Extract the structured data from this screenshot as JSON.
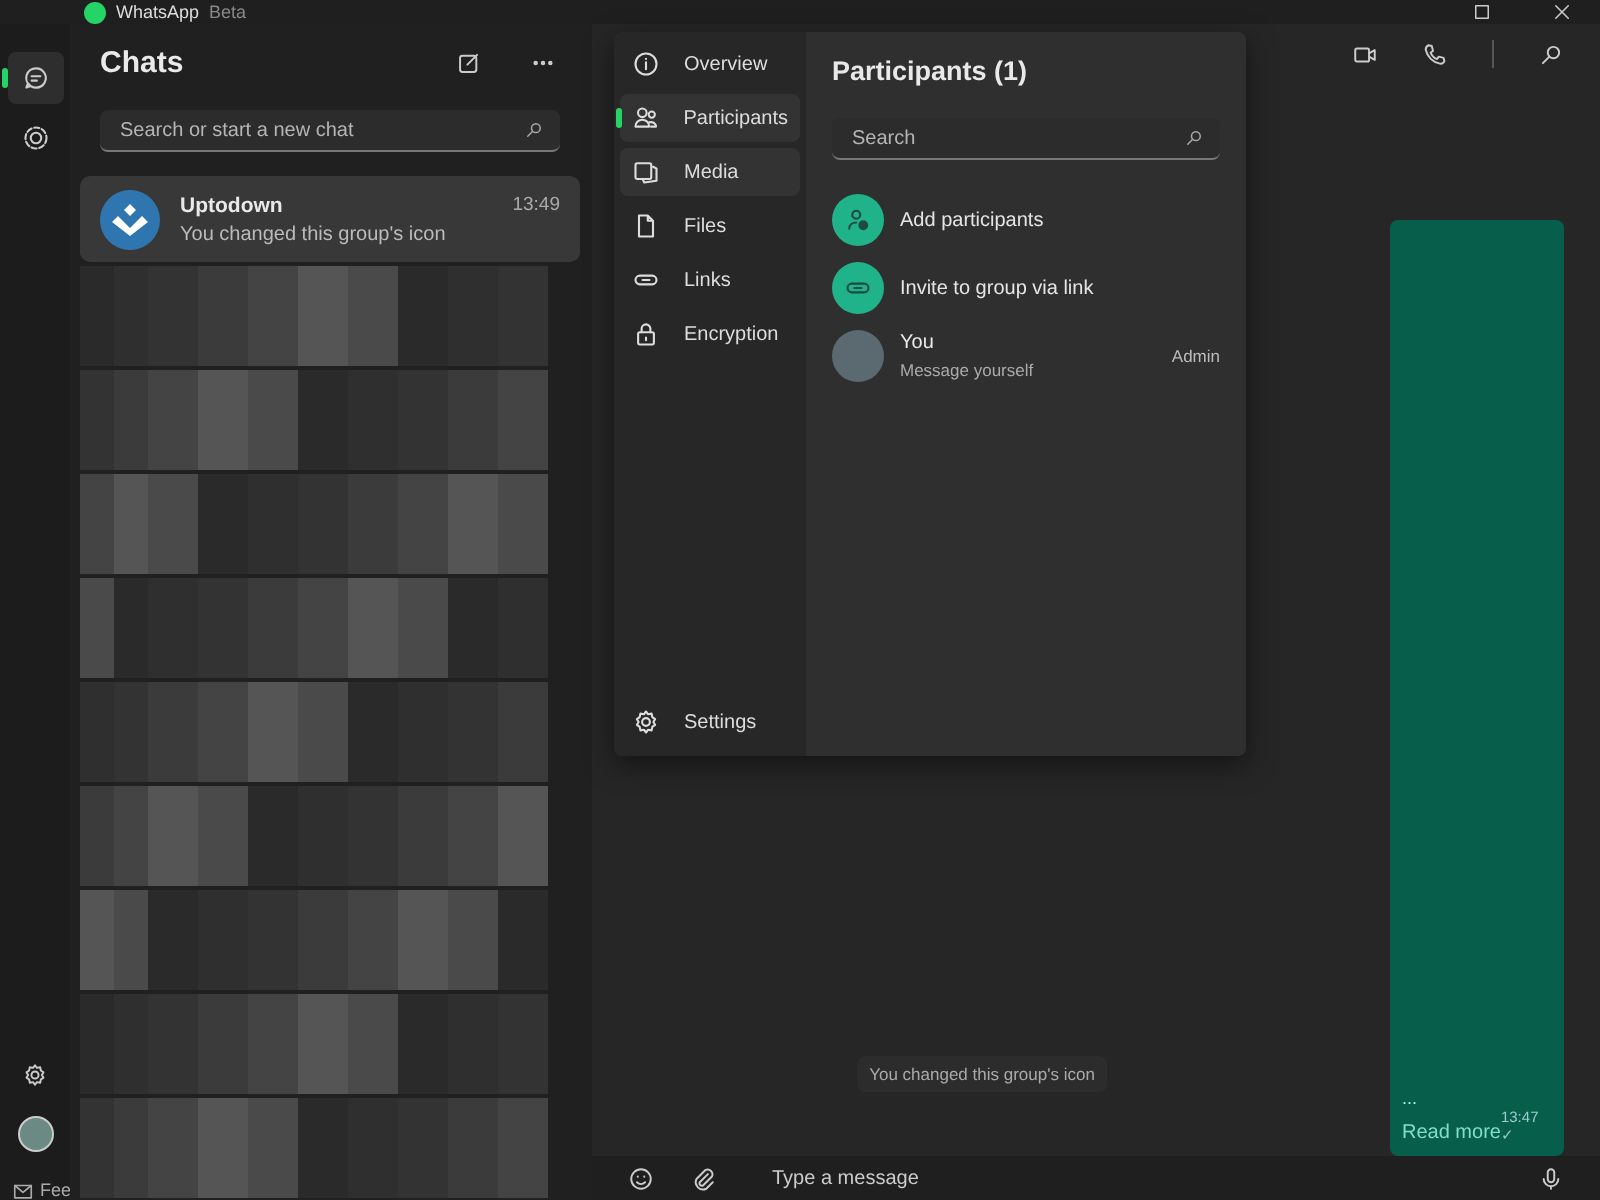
{
  "window": {
    "title": "WhatsApp",
    "subtitle": "Beta"
  },
  "rail": {
    "items": [
      {
        "kind": "chats",
        "selected": true
      },
      {
        "kind": "status",
        "selected": false
      }
    ],
    "footer_label": "Fee"
  },
  "chat_list": {
    "title": "Chats",
    "search": {
      "placeholder": "Search or start a new chat"
    },
    "chats": [
      {
        "name": "Uptodown",
        "preview": "You changed this group's icon",
        "time": "13:49",
        "selected": true
      }
    ]
  },
  "info_panel": {
    "nav": [
      {
        "label": "Overview",
        "kind": "info",
        "selected": false,
        "hovered": false
      },
      {
        "label": "Participants",
        "kind": "people",
        "selected": true,
        "hovered": false
      },
      {
        "label": "Media",
        "kind": "media",
        "selected": false,
        "hovered": true
      },
      {
        "label": "Files",
        "kind": "file",
        "selected": false,
        "hovered": false
      },
      {
        "label": "Links",
        "kind": "link",
        "selected": false,
        "hovered": false
      },
      {
        "label": "Encryption",
        "kind": "lock",
        "selected": false,
        "hovered": false
      }
    ],
    "settings_label": "Settings",
    "title": "Participants (1)",
    "search": {
      "placeholder": "Search"
    },
    "actions": [
      {
        "label": "Add participants",
        "kind": "add-person"
      },
      {
        "label": "Invite to group via link",
        "kind": "link"
      }
    ],
    "members": [
      {
        "name": "You",
        "status": "Message yourself",
        "role": "Admin"
      }
    ]
  },
  "conversation": {
    "message": {
      "text": "...",
      "link": "Read more",
      "time": "13:47",
      "ticks": "✓"
    },
    "system_notice": "You changed this group's icon",
    "composer": {
      "placeholder": "Type a message"
    }
  }
}
